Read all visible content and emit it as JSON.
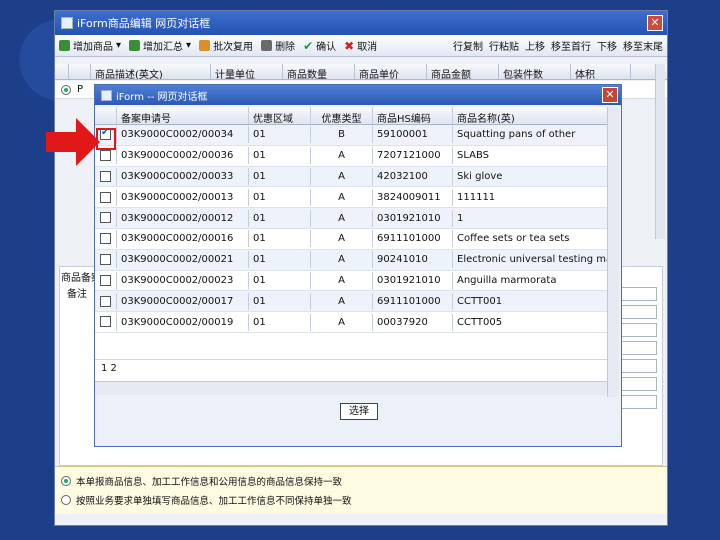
{
  "outer": {
    "title": "iForm商品编辑  网页对话框",
    "close": "✕",
    "toolbar": {
      "add_item": "增加商品",
      "add_summary": "增加汇总",
      "copy": "批次复用",
      "delete": "删除",
      "confirm": "确认",
      "cancel": "取消",
      "row_copy": "行复制",
      "row_paste": "行粘贴",
      "move_up": "上移",
      "move_to_top": "移至首行",
      "move_down": "下移",
      "move_to_bottom": "移至末尾"
    },
    "grid_headers": [
      "",
      "",
      "商品描述(英文)",
      "计量单位",
      "商品数量",
      "商品单价",
      "商品金额",
      "包装件数",
      "体积"
    ],
    "row1_radio": "P",
    "lower_label": "商品备案",
    "lower_sub": "备注",
    "status_options": [
      "本单报商品信息、加工工作信息和公用信息的商品信息保持一致",
      "按照业务要求单独填写商品信息、加工工作信息不同保持单独一致"
    ]
  },
  "dialog": {
    "title": "iForm -- 网页对话框",
    "close": "✕",
    "headers": [
      "",
      "备案申请号",
      "优惠区域",
      "优惠类型",
      "商品HS编码",
      "商品名称(英)"
    ],
    "rows": [
      {
        "checked": true,
        "no": "03K9000C0002/00034",
        "area": "01",
        "type": "B",
        "hs": "59100001",
        "name": "Squatting pans of other"
      },
      {
        "checked": false,
        "no": "03K9000C0002/00036",
        "area": "01",
        "type": "A",
        "hs": "7207121000",
        "name": "SLABS"
      },
      {
        "checked": false,
        "no": "03K9000C0002/00033",
        "area": "01",
        "type": "A",
        "hs": "42032100",
        "name": "Ski glove"
      },
      {
        "checked": false,
        "no": "03K9000C0002/00013",
        "area": "01",
        "type": "A",
        "hs": "3824009011",
        "name": "111111"
      },
      {
        "checked": false,
        "no": "03K9000C0002/00012",
        "area": "01",
        "type": "A",
        "hs": "0301921010",
        "name": "1"
      },
      {
        "checked": false,
        "no": "03K9000C0002/00016",
        "area": "01",
        "type": "A",
        "hs": "6911101000",
        "name": "Coffee sets or tea sets"
      },
      {
        "checked": false,
        "no": "03K9000C0002/00021",
        "area": "01",
        "type": "A",
        "hs": "90241010",
        "name": "Electronic universal testing machines"
      },
      {
        "checked": false,
        "no": "03K9000C0002/00023",
        "area": "01",
        "type": "A",
        "hs": "0301921010",
        "name": "Anguilla marmorata"
      },
      {
        "checked": false,
        "no": "03K9000C0002/00017",
        "area": "01",
        "type": "A",
        "hs": "6911101000",
        "name": "CCTT001"
      },
      {
        "checked": false,
        "no": "03K9000C0002/00019",
        "area": "01",
        "type": "A",
        "hs": "00037920",
        "name": "CCTT005"
      }
    ],
    "pager": "1 2",
    "select_button": "选择"
  }
}
